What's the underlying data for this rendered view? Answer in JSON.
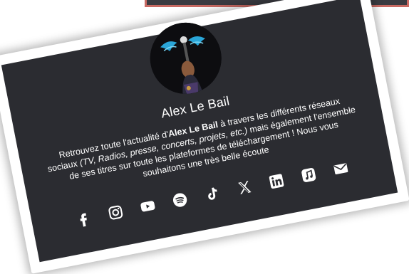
{
  "profile": {
    "name": "Alex Le Bail",
    "description": {
      "part1": "Retrouvez toute l'actualité d'",
      "bold_name": "Alex Le Bail",
      "part2": " à travers les différents réseaux sociaux ",
      "italic": "(TV, Radios, presse, concerts, projets, etc.)",
      "part3": " mais également l'ensemble de ses titres sur toute les plateformes de téléchargement ! Nous vous souhaitons une très belle écoute"
    }
  },
  "socials": [
    {
      "name": "facebook-icon"
    },
    {
      "name": "instagram-icon"
    },
    {
      "name": "youtube-icon"
    },
    {
      "name": "spotify-icon"
    },
    {
      "name": "tiktok-icon"
    },
    {
      "name": "x-icon"
    },
    {
      "name": "linkedin-icon"
    },
    {
      "name": "apple-music-icon"
    },
    {
      "name": "email-icon"
    }
  ],
  "colors": {
    "card_background": "#2b2c31",
    "frame": "#ffffff",
    "text": "#ffffff",
    "banner_border": "#c86a63"
  }
}
